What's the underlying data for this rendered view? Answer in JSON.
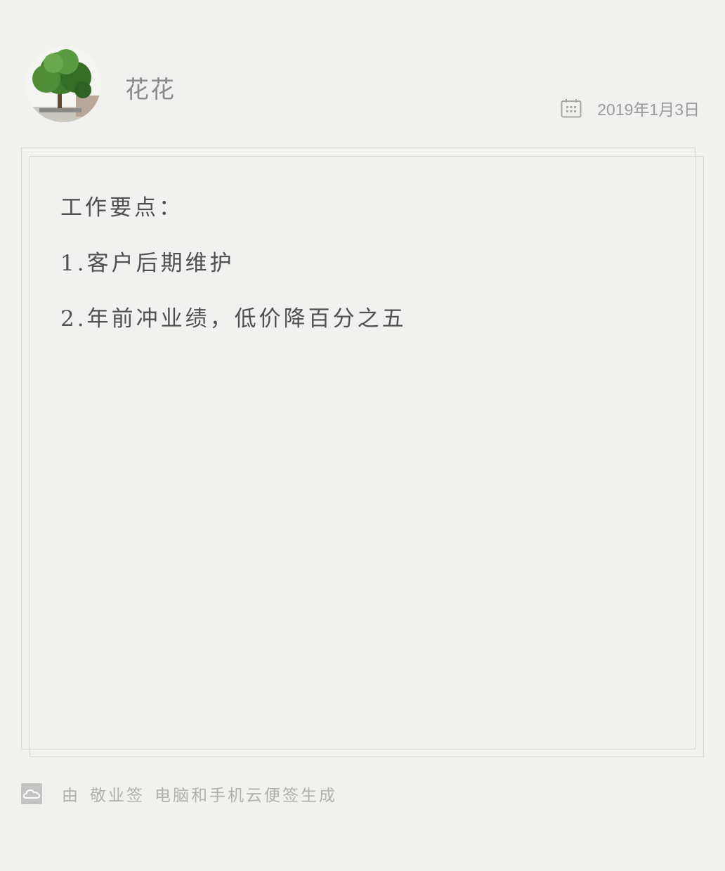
{
  "header": {
    "username": "花花",
    "date": "2019年1月3日",
    "avatar_icon": "tree-avatar-photo",
    "calendar_icon": "calendar-icon"
  },
  "note": {
    "lines": [
      "工作要点：",
      "1.客户后期维护",
      "2.年前冲业绩，低价降百分之五"
    ]
  },
  "footer": {
    "by": "由",
    "app_name": "敬业签",
    "tagline": "电脑和手机云便签生成",
    "logo_icon": "cloud-note-logo-icon"
  },
  "colors": {
    "background": "#f1f1ef",
    "frame_border": "#d8d8d6",
    "text": "#505050",
    "muted": "#9a9a9a"
  }
}
